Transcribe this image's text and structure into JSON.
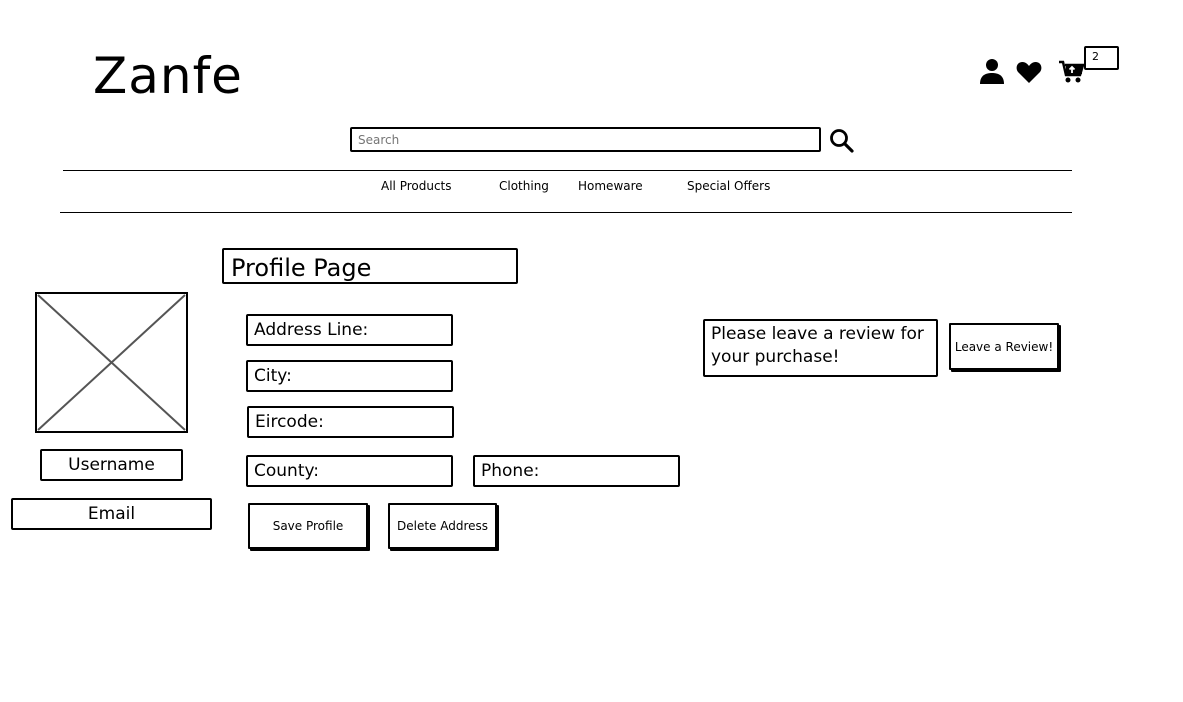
{
  "header": {
    "logo": "Zanfe",
    "cart_count": "2",
    "icons": [
      "user-icon",
      "heart-icon",
      "cart-icon"
    ]
  },
  "search": {
    "placeholder": "Search"
  },
  "nav": {
    "items": [
      "All Products",
      "Clothing",
      "Homeware",
      "Special Offers"
    ]
  },
  "profile": {
    "title": "Profile Page",
    "username": "Username",
    "email": "Email",
    "fields": {
      "address": "Address Line:",
      "city": "City:",
      "eircode": "Eircode:",
      "county": "County:",
      "phone": "Phone:"
    },
    "buttons": {
      "save": "Save Profile",
      "delete": "Delete Address"
    }
  },
  "review": {
    "prompt": "Please leave a review for your purchase!",
    "button": "Leave a Review!"
  }
}
